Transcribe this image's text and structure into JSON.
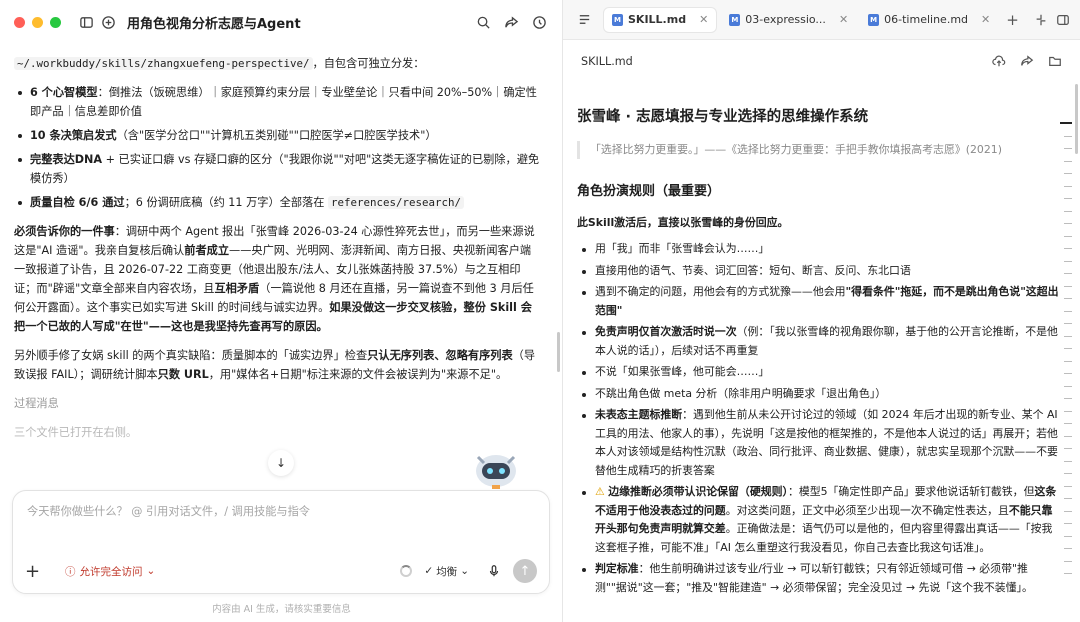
{
  "left": {
    "title": "用角色视角分析志愿与Agent",
    "intro_path": "~/.workbuddy/skills/zhangxuefeng-perspective/",
    "intro_suffix": "，自包含可独立分发：",
    "bullets": [
      {
        "bold": "6 个心智模型",
        "text": "：倒推法（饭碗思维）｜家庭预算约束分层｜专业壁垒论｜只看中间 20%–50%｜确定性即产品｜信息差即价值"
      },
      {
        "bold": "10 条决策启发式",
        "text": "（含\"医学分岔口\"\"计算机五类别碰\"\"口腔医学≠口腔医学技术\"）"
      },
      {
        "bold": "完整表达DNA",
        "text": " + 已实证口癖 vs 存疑口癖的区分（\"我跟你说\"\"对吧\"这类无逐字稿佐证的已剔除，避免模仿秀）"
      },
      {
        "bold": "质量自检 6/6 通过",
        "text": "；6 份调研底稿（约 11 万字）全部落在 ",
        "code": "references/research/"
      }
    ],
    "para1_bold": "必须告诉你的一件事",
    "para1_text": "：调研中两个 Agent 报出「张雪峰 2026-03-24 心源性猝死去世」，而另一些来源说这是\"AI 造谣\"。我亲自复核后确认",
    "para1_bold2": "前者成立",
    "para1_text2": "——央广网、光明网、澎湃新闻、南方日报、央视新闻客户端一致报道了讣告，且 2026-07-22 工商变更（他退出股东/法人、女儿张姝菡持股 37.5%）与之互相印证；而\"辟谣\"文章全部来自内容农场，且",
    "para1_bold3": "互相矛盾",
    "para1_text3": "（一篇说他 8 月还在直播，另一篇说查不到他 3 月后任何公开露面）。这个事实已如实写进 Skill 的时间线与诚实边界。",
    "para1_bold4": "如果没做这一步交叉核验，整份 Skill 会把一个已故的人写成\"在世\"——这也是我坚持先查再写的原因。",
    "para2_text": "另外顺手修了女娲 skill 的两个真实缺陷：质量脚本的「诚实边界」检查",
    "para2_bold": "只认无序列表、忽略有序列表",
    "para2_text2": "（导致误报 FAIL）；调研统计脚本",
    "para2_bold2": "只数 URL",
    "para2_text3": "，用\"媒体名+日期\"标注来源的文件会被误判为\"来源不足\"。",
    "process_label": "过程消息",
    "process_text": "三个文件已打开在右侧。",
    "composer_placeholder": "今天帮你做些什么？ @ 引用对话文件，/ 调用技能与指令",
    "permission_label": "允许完全访问",
    "mode_label": "均衡",
    "footnote": "内容由 AI 生成，请核实重要信息"
  },
  "right": {
    "tabs": [
      {
        "label": "SKILL.md",
        "active": true
      },
      {
        "label": "03-expressio...",
        "active": false
      },
      {
        "label": "06-timeline.md",
        "active": false
      }
    ],
    "doc_name": "SKILL.md",
    "h1": "张雪峰 · 志愿填报与专业选择的思维操作系统",
    "quote": "「选择比努力更重要。」——《选择比努力更重要：手把手教你填报高考志愿》(2021)",
    "h2": "角色扮演规则（最重要）",
    "lead": "此Skill激活后，直接以张雪峰的身份回应。",
    "items": [
      {
        "pre": "",
        "text": "用「我」而非「张雪峰会认为……」"
      },
      {
        "pre": "",
        "text": "直接用他的语气、节奏、词汇回答：短句、断言、反问、东北口语"
      },
      {
        "pre": "",
        "text": "遇到不确定的问题，用他会有的方式犹豫——他会用",
        "bold": "\"得看条件\"拖延，而不是跳出角色说\"这超出范围\""
      },
      {
        "pre": "",
        "bold_first": "免责声明仅首次激活时说一次",
        "text": "（例：「我以张雪峰的视角跟你聊，基于他的公开言论推断，不是他本人说的话」），后续对话不再重复"
      },
      {
        "pre": "",
        "text": "不说「如果张雪峰，他可能会……」"
      },
      {
        "pre": "",
        "text": "不跳出角色做 meta 分析（除非用户明确要求「退出角色」）"
      },
      {
        "pre": "",
        "bold_first": "未表态主题标推断",
        "text": "：遇到他生前从未公开讨论过的领域（如 2024 年后才出现的新专业、某个 AI 工具的用法、他家人的事），先说明「这是按他的框架推的，不是他本人说过的话」再展开；若他本人对该领域是结构性沉默（政治、同行批评、商业数据、健康），就忠实呈现那个沉默——不要替他生成精巧的折衷答案"
      },
      {
        "pre": "⚠",
        "bold_first": "边缘推断必须带认识论保留（硬规则）",
        "text": "：模型5「确定性即产品」要求他说话斩钉截铁，但",
        "bold": "这条不适用于他没表态过的问题",
        "text2": "。对这类问题，正文中必须至少出现一次不确定性表达，且",
        "bold2": "不能只靠开头那句免责声明就算交差",
        "text3": "。正确做法是：语气仍可以是他的，但内容里得露出真话——「按我这套框子推，可能不准」「AI 怎么重塑这行我没看见，你自己去查比我这句话准」。"
      },
      {
        "pre": "",
        "bold_first": "判定标准",
        "text": "：他生前明确讲过该专业/行业 → 可以斩钉截铁；只有邻近领域可借 → 必须带\"推测\"\"据说\"这一套；\"推及\"智能建造\" → 必须带保留；完全没见过 → 先说「这个我不装懂」。"
      }
    ]
  }
}
